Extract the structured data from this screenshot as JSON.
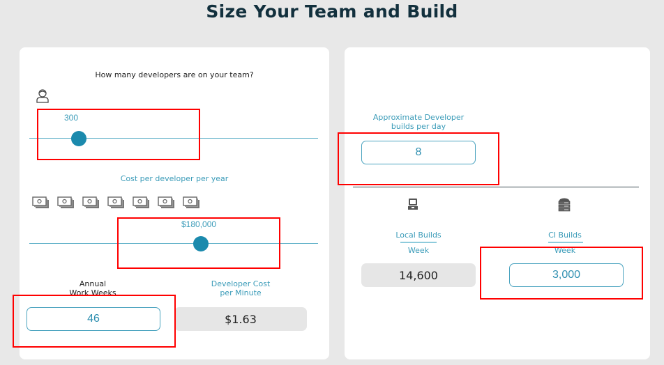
{
  "page": {
    "title": "Size Your Team and Build"
  },
  "team": {
    "question": "How many developers are on your team?",
    "icon": "person-icon",
    "developer_count": {
      "value": "300",
      "slider_fraction": 0.15
    }
  },
  "cost": {
    "label": "Cost per developer per year",
    "money_icons": [
      "money-stack-icon",
      "money-stack-icon",
      "money-stack-icon",
      "money-stack-icon",
      "money-stack-icon",
      "money-stack-icon",
      "money-stack-icon"
    ],
    "annual_cost": {
      "value": "$180,000",
      "slider_fraction": 0.59
    }
  },
  "work_weeks": {
    "label_line1": "Annual",
    "label_line2": "Work Weeks",
    "value": "46"
  },
  "cost_per_minute": {
    "label_line1": "Developer Cost",
    "label_line2": "per Minute",
    "value": "$1.63"
  },
  "builds_per_day": {
    "label_line1": "Approximate Developer",
    "label_line2": "builds per day",
    "value": "8"
  },
  "local_builds": {
    "icon": "laptop-icon",
    "label": "Local Builds",
    "sublabel": "Week",
    "value": "14,600"
  },
  "ci_builds": {
    "icon": "server-icon",
    "label": "CI Builds",
    "sublabel": "Week",
    "value": "3,000"
  },
  "colors": {
    "accent": "#1b8aad",
    "accent_text": "#3a9bb8",
    "title": "#12303d",
    "highlight": "#ff0000"
  }
}
